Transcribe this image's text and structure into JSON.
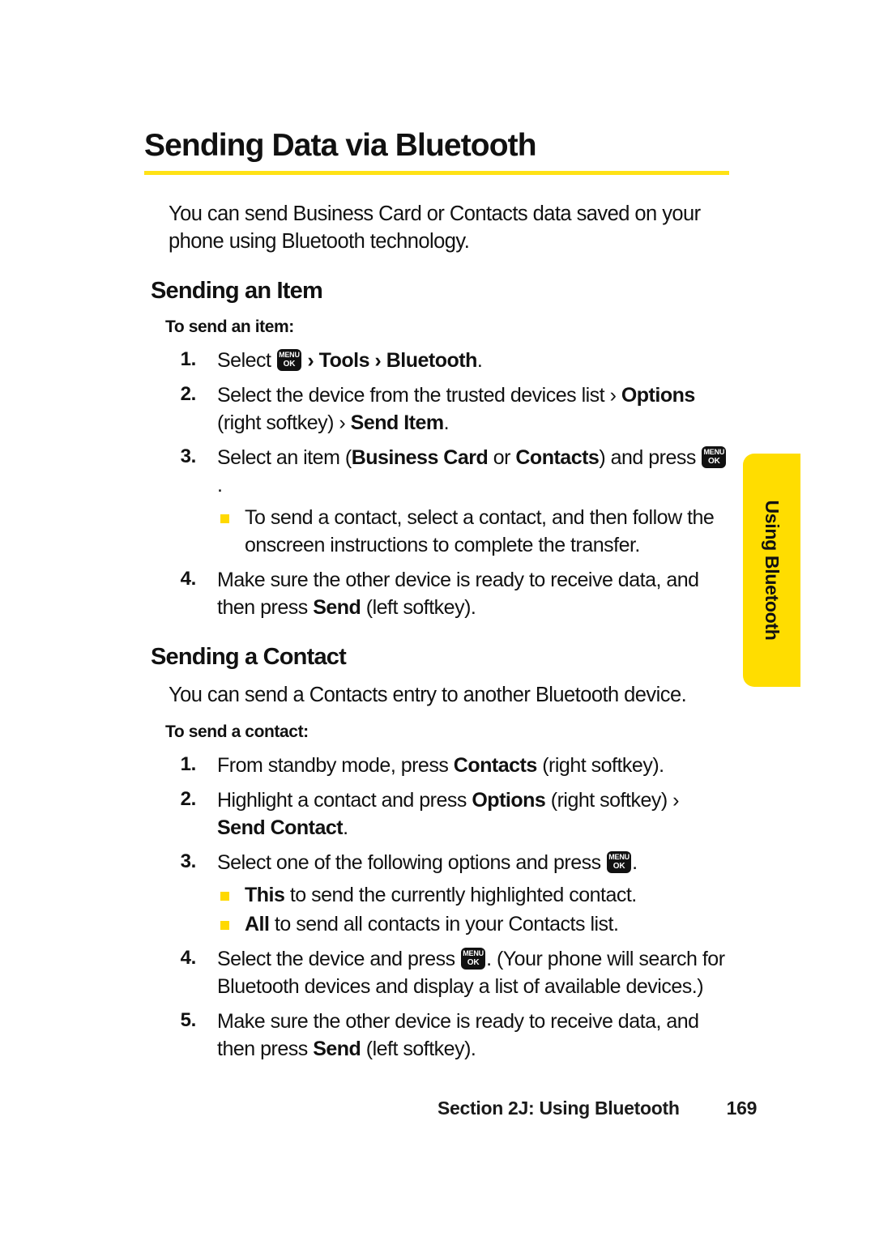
{
  "page": {
    "title": "Sending Data via Bluetooth",
    "accent_rule_color": "#FFE216",
    "bullet_color": "#FFD900",
    "tab_color": "#FFDD00",
    "background": "#FFFFFF"
  },
  "intro": "You can send Business Card or Contacts data saved on your phone using Bluetooth technology.",
  "menu_key": {
    "top": "MENU",
    "bottom": "OK"
  },
  "chevron": "›",
  "section_item": {
    "heading": "Sending an Item",
    "lead": "To send an item:",
    "steps": [
      {
        "num": "1.",
        "parts": [
          {
            "t": "Select ",
            "b": false
          },
          {
            "t": "MENUKEY",
            "b": false
          },
          {
            "t": " ",
            "b": false
          },
          {
            "t": "› ",
            "b": true
          },
          {
            "t": "Tools",
            "b": true
          },
          {
            "t": " › ",
            "b": true
          },
          {
            "t": "Bluetooth",
            "b": true
          },
          {
            "t": ".",
            "b": false
          }
        ]
      },
      {
        "num": "2.",
        "parts": [
          {
            "t": "Select the device from the trusted devices list › ",
            "b": false
          },
          {
            "t": "Options",
            "b": true
          },
          {
            "t": " (right softkey) › ",
            "b": false
          },
          {
            "t": "Send Item",
            "b": true
          },
          {
            "t": ".",
            "b": false
          }
        ]
      },
      {
        "num": "3.",
        "parts": [
          {
            "t": "Select an item (",
            "b": false
          },
          {
            "t": "Business Card",
            "b": true
          },
          {
            "t": " or ",
            "b": false
          },
          {
            "t": "Contacts",
            "b": true
          },
          {
            "t": ") and press ",
            "b": false
          },
          {
            "t": "MENUKEY",
            "b": false
          },
          {
            "t": ".",
            "b": false
          }
        ],
        "sub": [
          {
            "parts": [
              {
                "t": "To send a contact, select a contact, and then follow the onscreen instructions to complete the transfer.",
                "b": false
              }
            ]
          }
        ]
      },
      {
        "num": "4.",
        "parts": [
          {
            "t": "Make sure the other device is ready to receive data, and then press ",
            "b": false
          },
          {
            "t": "Send",
            "b": true
          },
          {
            "t": " (left softkey).",
            "b": false
          }
        ]
      }
    ]
  },
  "section_contact": {
    "heading": "Sending a Contact",
    "intro": "You can send a Contacts entry to another Bluetooth device.",
    "lead": "To send a contact:",
    "steps": [
      {
        "num": "1.",
        "parts": [
          {
            "t": "From standby mode, press ",
            "b": false
          },
          {
            "t": "Contacts",
            "b": true
          },
          {
            "t": " (right softkey).",
            "b": false
          }
        ]
      },
      {
        "num": "2.",
        "parts": [
          {
            "t": "Highlight a contact and press ",
            "b": false
          },
          {
            "t": "Options",
            "b": true
          },
          {
            "t": " (right softkey) › ",
            "b": false
          },
          {
            "t": "Send Contact",
            "b": true
          },
          {
            "t": ".",
            "b": false
          }
        ]
      },
      {
        "num": "3.",
        "parts": [
          {
            "t": "Select one of the following options and press ",
            "b": false
          },
          {
            "t": "MENUKEY",
            "b": false
          },
          {
            "t": ".",
            "b": false
          }
        ],
        "sub": [
          {
            "parts": [
              {
                "t": "This",
                "b": true
              },
              {
                "t": " to send the currently highlighted contact.",
                "b": false
              }
            ]
          },
          {
            "parts": [
              {
                "t": "All",
                "b": true
              },
              {
                "t": " to send all contacts in your Contacts list.",
                "b": false
              }
            ]
          }
        ]
      },
      {
        "num": "4.",
        "parts": [
          {
            "t": "Select the device and press ",
            "b": false
          },
          {
            "t": "MENUKEY",
            "b": false
          },
          {
            "t": ". (Your phone will search for Bluetooth devices and display a list of available devices.)",
            "b": false
          }
        ]
      },
      {
        "num": "5.",
        "parts": [
          {
            "t": "Make sure the other device is ready to receive data, and then press ",
            "b": false
          },
          {
            "t": "Send",
            "b": true
          },
          {
            "t": " (left softkey).",
            "b": false
          }
        ]
      }
    ]
  },
  "side_tab": {
    "label": "Using Bluetooth"
  },
  "footer": {
    "section": "Section 2J: Using Bluetooth",
    "page_number": "169"
  }
}
